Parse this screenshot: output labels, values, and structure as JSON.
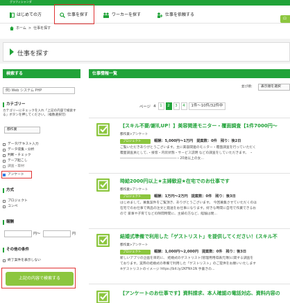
{
  "header": {
    "subtitle": "グラフィシャンダ"
  },
  "nav": {
    "items": [
      {
        "label": "はじめての方"
      },
      {
        "label": "仕事を探す"
      },
      {
        "label": "ワーカーを探す"
      },
      {
        "label": "仕事を依頼する"
      }
    ],
    "cta_label": "ロ"
  },
  "breadcrumb": {
    "home": "ホーム",
    "sep": ">",
    "current": "仕事を探す"
  },
  "page": {
    "title": "仕事を探す"
  },
  "sidebar": {
    "header": "検索する",
    "keyword_value": "例) Web システム PHP",
    "category_label": "カテゴリー",
    "category_help": "カテゴリーにチェックを入れ「上記の内容で検索する」ボタンを押してください。（複数選択可）",
    "category_select": "都作業",
    "categories": [
      {
        "label": "データ/テキスト入力",
        "checked": false
      },
      {
        "label": "データ収集・分析",
        "checked": false
      },
      {
        "label": "判断・チェック",
        "checked": false
      },
      {
        "label": "テープ起こし",
        "checked": false
      },
      {
        "label": "調査・取材",
        "checked": false
      },
      {
        "label": "アンケート",
        "checked": true
      }
    ],
    "method_label": "方式",
    "methods": [
      {
        "label": "プロジェクト",
        "checked": false
      },
      {
        "label": "コンペ",
        "checked": false
      }
    ],
    "reward_label": "報酬",
    "reward_from": "",
    "reward_sep": "円〜",
    "reward_to": "",
    "reward_unit": "円",
    "other_label": "その他の条件",
    "other_option": "終了案件を表示しない",
    "search_button": "上記の内容で検索する"
  },
  "main": {
    "header": "仕事情報一覧",
    "sort_label": "並び順：",
    "sort_value": "表示順を選択",
    "pager": {
      "page_label": "ページ",
      "current_page": "4",
      "pages": [
        "1",
        "2",
        "3",
        "4"
      ],
      "range": "1件〜10件/32件中"
    },
    "jobs": [
      {
        "title": "【スキル不要/謝礼UP！】美容関連モニター・覆面調査【1件7000円〜",
        "category": "都作業>アンケート",
        "tag": "プロジェクト",
        "reward": "報酬：5,000円〜1万円",
        "proposals": "提案数：0件",
        "remaining": "残り：後2日",
        "desc1": "ご覧いただきありがとうございます。主に美容関連のモニター・覆面調査を行っていただく",
        "desc2": "覆面調査員として、・接客・内装状態・サービス説明 などの調査をしていただきます。 ・",
        "desc3": "―――――――――――――――――・20歳以上の女..."
      },
      {
        "title": "時給2000円以上★主婦歓迎★在宅でのお仕事です",
        "category": "都作業>アンケート",
        "tag": "プロジェクト",
        "reward": "報酬：1万円〜2万円",
        "proposals": "提案数：0件",
        "remaining": "残り：後3日",
        "desc1": "はじめまして。募集案件をご覧頂き、ありがとうございます。 今回募集させていただくのは",
        "desc2": "在宅でのお仕事で商品の注文と発送をお仕事になります。好きな時間に自宅で作業できるお",
        "desc3": "ので 家事や子育てなどの隙間時間に、主婦の方など、経験は問..."
      },
      {
        "title": "結婚式準備で利用した「ゲストリスト」を提供してください！(スキル不",
        "category": "都作業>アンケート",
        "tag": "プロジェクト",
        "reward": "報酬：1,000円〜2,000円",
        "proposals": "提案数：0件",
        "remaining": "残り：後3日",
        "desc1": "新しいアプリの企画を目的に、 結婚式のゲストリスト(管理用用得表元簿)に関する調査を",
        "desc2": "ております。実際の結婚式の準備で利用した「ゲストリスト」のご提供をお願いいたします",
        "desc3": "※ゲストリストのイメージ https://bit.ly/2KFNh1N 手書きの..."
      },
      {
        "title": "【アンケートのお仕事です】資料請求、本人確認の電話対応、資料内容の"
      }
    ]
  }
}
